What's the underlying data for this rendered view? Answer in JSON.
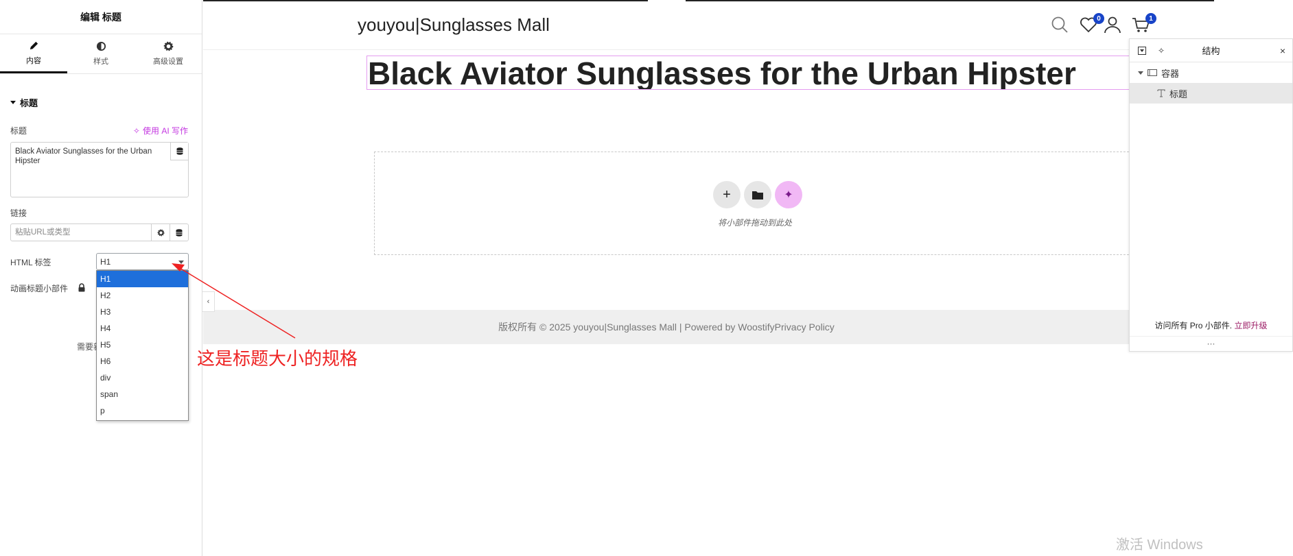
{
  "panel": {
    "header": "编辑 标题",
    "tabs": [
      {
        "label": "内容",
        "icon": "pencil-icon"
      },
      {
        "label": "样式",
        "icon": "half-circle-icon"
      },
      {
        "label": "高级设置",
        "icon": "gear-icon"
      }
    ],
    "section_title": "标题",
    "title_label": "标题",
    "ai_link": "使用 AI 写作",
    "title_value": "Black Aviator Sunglasses for the Urban Hipster",
    "link_label": "链接",
    "link_placeholder": "粘贴URL或类型",
    "html_tag_label": "HTML 标签",
    "html_tag_value": "H1",
    "html_tag_options": [
      "H1",
      "H2",
      "H3",
      "H4",
      "H5",
      "H6",
      "div",
      "span",
      "p"
    ],
    "animated_label": "动画标题小部件",
    "note_text": "需要新"
  },
  "site": {
    "title": "youyou|Sunglasses Mall",
    "wishlist_count": "0",
    "cart_count": "1",
    "heading": "Black Aviator Sunglasses for the Urban Hipster",
    "drop_text": "将小部件拖动到此处",
    "footer": "版权所有 © 2025 youyou|Sunglasses Mall | Powered by WoostifyPrivacy Policy"
  },
  "annotation": "这是标题大小的规格",
  "structure": {
    "title": "结构",
    "tree": [
      {
        "label": "容器",
        "icon": "container-icon"
      },
      {
        "label": "标题",
        "icon": "text-icon"
      }
    ],
    "upgrade_text": "访问所有 Pro 小部件.",
    "upgrade_link": "立即升级",
    "more": "···"
  },
  "watermark": "激活 Windows",
  "colors": {
    "accent": "#c336e0",
    "selection": "#1e6fdb",
    "badge": "#1844c8",
    "annotation": "#ee2222"
  }
}
